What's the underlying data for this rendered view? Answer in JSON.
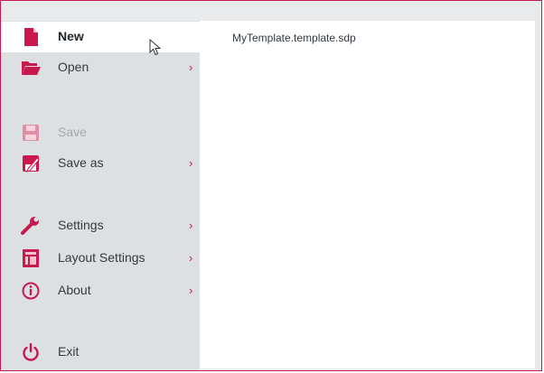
{
  "menu": {
    "items": [
      {
        "label": "New",
        "icon": "new-document-icon"
      },
      {
        "label": "Open",
        "icon": "folder-open-icon",
        "chevron": "›"
      },
      {
        "label": "Save",
        "icon": "save-icon"
      },
      {
        "label": "Save as",
        "icon": "save-as-icon",
        "chevron": "›"
      },
      {
        "label": "Settings",
        "icon": "wrench-icon",
        "chevron": "›"
      },
      {
        "label": "Layout Settings",
        "icon": "layout-icon",
        "chevron": "›"
      },
      {
        "label": "About",
        "icon": "info-icon",
        "chevron": "›"
      },
      {
        "label": "Exit",
        "icon": "power-icon"
      }
    ]
  },
  "content": {
    "filename": "MyTemplate.template.sdp"
  },
  "colors": {
    "accent": "#c8184e",
    "sidebar_bg": "#dde0e3",
    "disabled_icon": "#e08ea6"
  }
}
